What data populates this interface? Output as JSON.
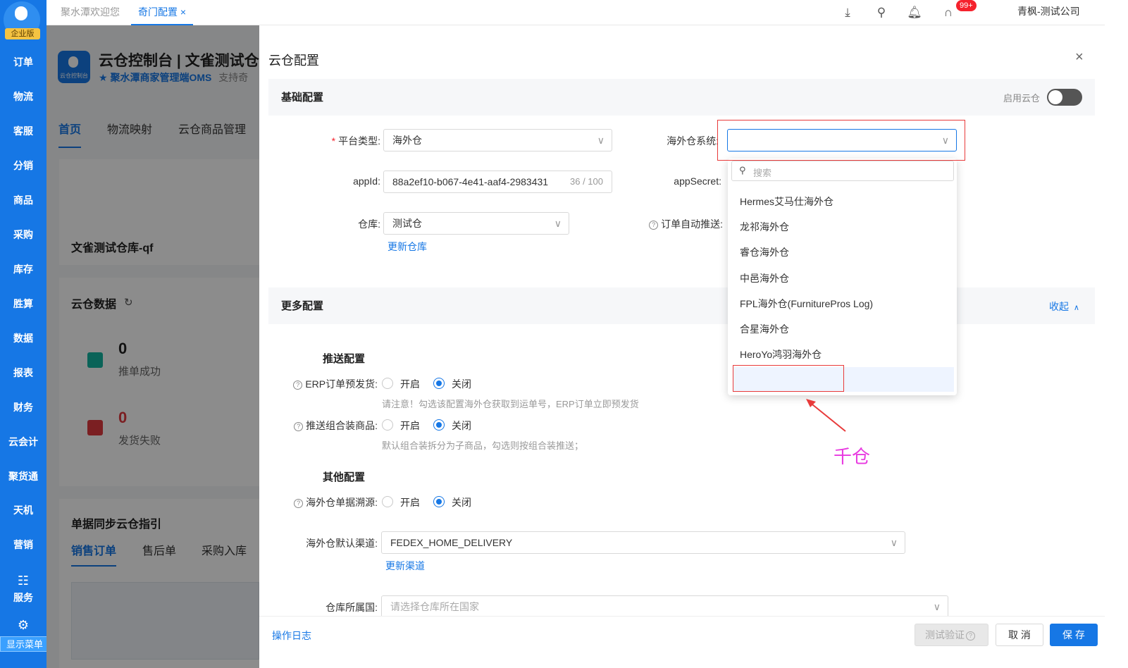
{
  "nav": {
    "edition": "企业版",
    "items": [
      "订单",
      "物流",
      "客服",
      "分销",
      "商品",
      "采购",
      "库存",
      "胜算",
      "数据",
      "报表",
      "财务",
      "云会计",
      "聚货通",
      "天机",
      "营销"
    ],
    "service": "服务",
    "show_menu": "显示菜单"
  },
  "tabs": {
    "welcome": "聚水潭欢迎您",
    "active": "奇门配置",
    "close": "×"
  },
  "topbar": {
    "badge": "99+",
    "user": "青枫-测试公司[qingfengqi]"
  },
  "bg_page": {
    "title": "云仓控制台",
    "sep": "|",
    "title2": "文雀测试仓",
    "logo_text": "云仓控制台",
    "subtitle": "★ 聚水潭商家管理端OMS",
    "subtitle2": "支持奇",
    "tabs": [
      "首页",
      "物流映射",
      "云仓商品管理"
    ],
    "warehouse": "文雀测试仓库-qf",
    "data_title": "云仓数据",
    "success_count": "0",
    "success_label": "推单成功",
    "fail_count": "0",
    "fail_label": "发货失败",
    "guide_title": "单据同步云仓指引",
    "guide_tabs": [
      "销售订单",
      "售后单",
      "采购入库"
    ]
  },
  "drawer": {
    "title": "云仓配置",
    "close": "×",
    "basic": {
      "title": "基础配置",
      "enable_label": "启用云仓",
      "enabled": false,
      "platform_label": "平台类型",
      "platform_value": "海外仓",
      "appid_label": "appId",
      "appid_value": "88a2ef10-b067-4e41-aaf4-2983431",
      "appid_count": "36 / 100",
      "warehouse_label": "仓库",
      "warehouse_value": "测试仓",
      "update_warehouse": "更新仓库",
      "overseas_system_label": "海外仓系统",
      "appsecret_label": "appSecret",
      "auto_push_label": "订单自动推送"
    },
    "more": {
      "title": "更多配置",
      "collapse": "收起",
      "push_title": "推送配置",
      "erp_label": "ERP订单预发货",
      "open": "开启",
      "close": "关闭",
      "erp_hint": "请注意！勾选该配置海外仓获取到运单号，ERP订单立即预发货",
      "combo_label": "推送组合装商品",
      "combo_hint": "默认组合装拆分为子商品，勾选则按组合装推送；",
      "other_title": "其他配置",
      "trace_label": "海外仓单据溯源",
      "channel_label": "海外仓默认渠道",
      "channel_value": "FEDEX_HOME_DELIVERY",
      "update_channel": "更新渠道",
      "country_label": "仓库所属国",
      "country_placeholder": "请选择仓库所在国家"
    },
    "footer": {
      "log": "操作日志",
      "test": "测试验证",
      "cancel": "取 消",
      "save": "保 存"
    }
  },
  "dropdown": {
    "search_placeholder": "搜索",
    "options": [
      "Hermes艾马仕海外仓",
      "龙祁海外仓",
      "睿仓海外仓",
      "中邑海外仓",
      "FPL海外仓(FurniturePros Log)",
      "合星海外仓",
      "HeroYo鸿羽海外仓"
    ]
  },
  "annotation": {
    "text": "千仓",
    "color": "#e83ae0",
    "box_color": "#e83a3a"
  }
}
